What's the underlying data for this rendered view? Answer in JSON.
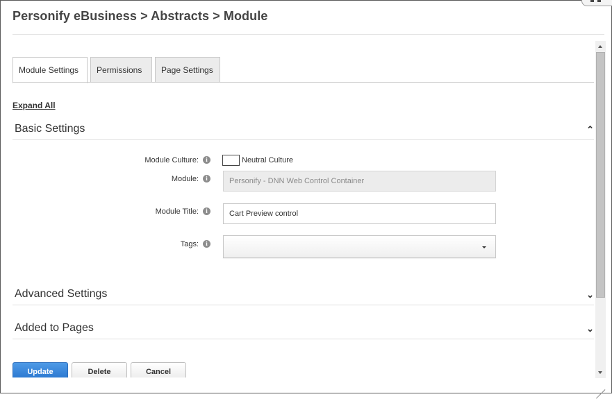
{
  "window": {
    "title": "Personify eBusiness > Abstracts > Module"
  },
  "tabs": [
    {
      "label": "Module Settings",
      "active": true
    },
    {
      "label": "Permissions",
      "active": false
    },
    {
      "label": "Page Settings",
      "active": false
    }
  ],
  "expand_all": "Expand All",
  "sections": {
    "basic": {
      "label": "Basic Settings",
      "state": "expanded",
      "chevron_icon": "chevron-up-icon"
    },
    "advanced": {
      "label": "Advanced Settings",
      "state": "collapsed",
      "chevron_icon": "chevron-down-icon"
    },
    "added_to_pages": {
      "label": "Added to Pages",
      "state": "collapsed",
      "chevron_icon": "chevron-down-icon"
    }
  },
  "fields": {
    "module_culture": {
      "label": "Module Culture:",
      "value": "Neutral Culture",
      "icon": "info-icon"
    },
    "module": {
      "label": "Module:",
      "value": "Personify - DNN Web Control Container",
      "icon": "info-icon",
      "disabled": true
    },
    "module_title": {
      "label": "Module Title:",
      "value": "Cart Preview control",
      "icon": "info-icon"
    },
    "tags": {
      "label": "Tags:",
      "value": "",
      "icon": "info-icon"
    }
  },
  "buttons": {
    "update": "Update",
    "delete": "Delete",
    "cancel": "Cancel"
  },
  "colors": {
    "primary_button": "#2a77d0",
    "border": "#c8c8c8",
    "disabled_input": "#ececec"
  }
}
